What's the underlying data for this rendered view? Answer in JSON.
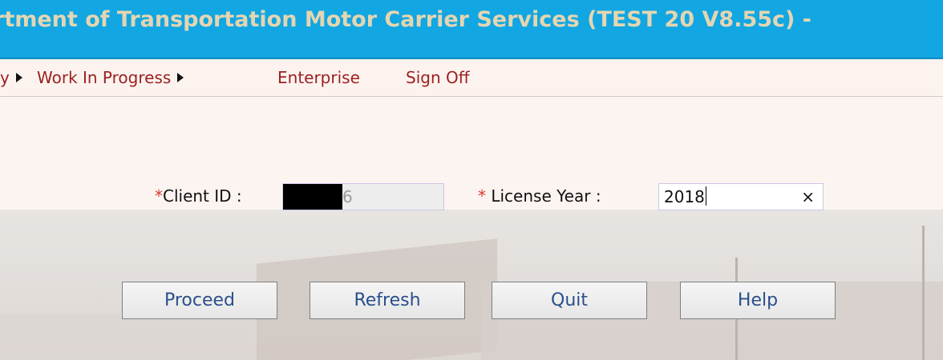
{
  "header": {
    "title": "rtment of Transportation Motor Carrier Services (TEST 20 V8.55c) -"
  },
  "menu": {
    "items": [
      {
        "label": "y",
        "has_submenu": true
      },
      {
        "label": "Work In Progress",
        "has_submenu": true
      },
      {
        "label": "Enterprise",
        "has_submenu": false
      },
      {
        "label": "Sign Off",
        "has_submenu": false
      }
    ]
  },
  "form": {
    "required_marker": "*",
    "client_id_label": "Client ID :",
    "client_id_visible_value": "6",
    "license_year_label": " License Year :",
    "license_year_value": "2018",
    "clear_symbol": "×"
  },
  "buttons": {
    "proceed": "Proceed",
    "refresh": "Refresh",
    "quit": "Quit",
    "help": "Help"
  },
  "colors": {
    "header_bg": "#12a6e2",
    "header_text": "#e4d6b2",
    "menu_text": "#9c1f1f",
    "required_marker": "#d9392b",
    "button_text": "#2a4f8c"
  }
}
